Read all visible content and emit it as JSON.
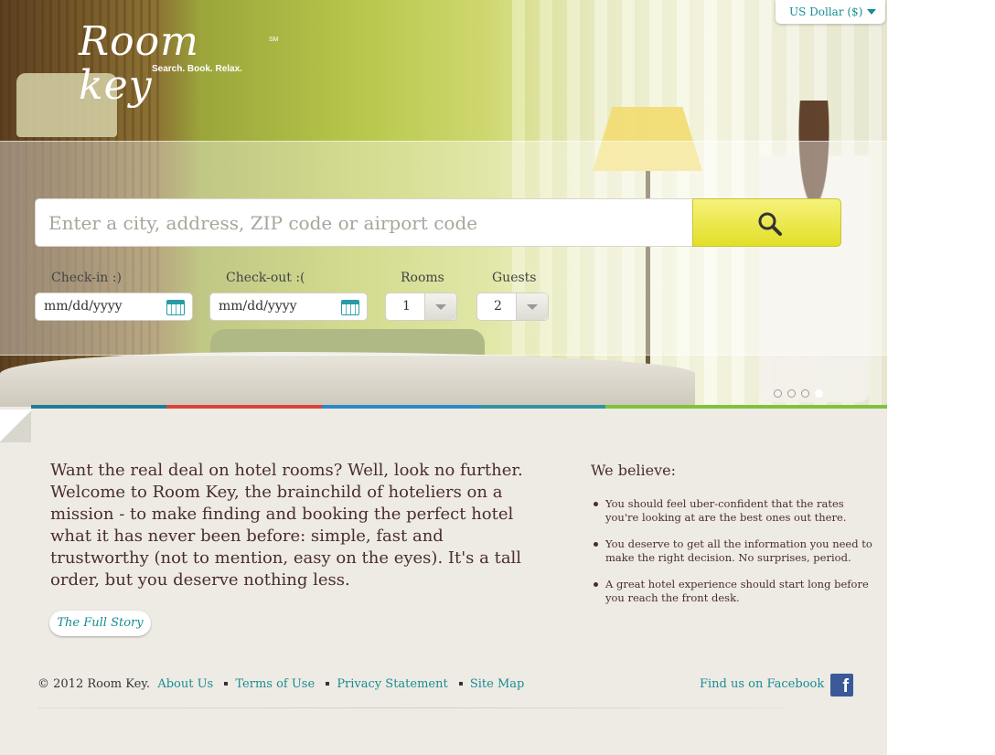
{
  "logo": {
    "wordmark": "Room key",
    "service_mark": "SM",
    "tagline": "Search. Book. Relax."
  },
  "currency": {
    "label": "US Dollar ($)"
  },
  "search": {
    "placeholder": "Enter a city, address, ZIP code or airport code",
    "button_icon": "search-icon"
  },
  "booking": {
    "checkin_label": "Check-in :)",
    "checkout_label": "Check-out :(",
    "rooms_label": "Rooms",
    "guests_label": "Guests",
    "checkin_value": "mm/dd/yyyy",
    "checkout_value": "mm/dd/yyyy",
    "rooms_value": "1",
    "guests_value": "2"
  },
  "carousel": {
    "slide_count": 4,
    "active_index": 3
  },
  "colors": {
    "accent_teal": "#188c94",
    "text_brown": "#4a2d2b",
    "button_yellow": "#e8e535",
    "stripe": [
      "#1f7d9a",
      "#d9453a",
      "#2c89c6",
      "#2f94a0",
      "#7fc23c"
    ]
  },
  "intro": {
    "text": "Want the real deal on hotel rooms? Well, look no further. Welcome to Room Key, the brainchild of hoteliers on a mission - to make finding and booking the perfect hotel what it has never been before: simple, fast and trustworthy (not to mention, easy on the eyes). It's a tall order, but you deserve nothing less.",
    "button_label": "The Full Story"
  },
  "beliefs": {
    "title": "We believe:",
    "items": [
      "You should feel uber-confident that the rates you're looking at are the best ones out there.",
      "You deserve to get all the information you need to make the right decision. No surprises, period.",
      "A great hotel experience should start long before you reach the front desk."
    ]
  },
  "footer": {
    "copyright": "© 2012 Room Key.",
    "links": [
      "About Us",
      "Terms of Use",
      "Privacy Statement",
      "Site Map"
    ],
    "facebook_label": "Find us on Facebook",
    "facebook_icon": "facebook-icon"
  }
}
